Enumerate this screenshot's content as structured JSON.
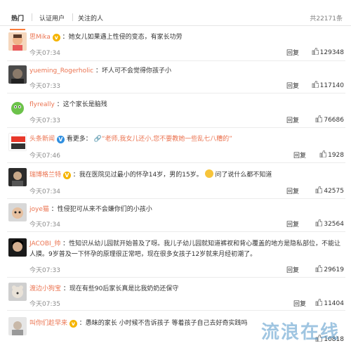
{
  "tabs": [
    "热门",
    "认证用户",
    "关注的人"
  ],
  "total": "共22171条",
  "reply_label": "回复",
  "comments": [
    {
      "user": "思Mika",
      "text": "：她女儿如果遇上性侵的变态，有家长功劳",
      "time": "今天07:34",
      "likes": "129348",
      "badge": "v-yellow"
    },
    {
      "user": "yueming_Rogerholic",
      "text": "：坏人可不会觉得你孩子小",
      "time": "今天07:33",
      "likes": "117140",
      "badge": ""
    },
    {
      "user": "flyreally",
      "text": "：这个家长是脑残",
      "time": "今天07:33",
      "likes": "76686",
      "badge": ""
    },
    {
      "user": "头条新闻",
      "text_pre": " 看更多：",
      "link": "“老师,我女儿还小,您不要教她一些乱七八糟的”",
      "time": "今天07:46",
      "likes": "1928",
      "badge": "V-blue",
      "avatar_text": "头条\n新闻"
    },
    {
      "user": "瑞博格兰特",
      "text": "：我在医院见过最小的怀孕14岁，男的15岁。",
      "text_post": "问了说什么都不知道",
      "time": "今天07:34",
      "likes": "42575",
      "badge": "V"
    },
    {
      "user": "joye猫",
      "text": "：性侵犯可从来不会嫌你们的小孩小",
      "time": "今天07:34",
      "likes": "32564",
      "badge": ""
    },
    {
      "user": "JACOBI_帅",
      "text": "：性知识从幼儿园就开始普及了呀。我儿子幼儿园就知道裤衩和背心覆盖的地方是隐私部位，不能让人摸。9岁普及一下怀孕的原理很正常吧，现在很多女孩子12岁就来月经初潮了。",
      "time": "今天07:33",
      "likes": "29619",
      "badge": ""
    },
    {
      "user": "渡边小狗宝",
      "text": "：现在有些90后家长真是比我奶奶还保守",
      "time": "今天07:35",
      "likes": "11404",
      "badge": ""
    },
    {
      "user": "叫你们趁早来",
      "text": "：愚昧的家长 小时候不告诉孩子 等着孩子自己去好奇实践吗",
      "time": "",
      "likes": "10818",
      "badge": "v-yellow"
    }
  ],
  "watermark": "流浪在线",
  "colors": {
    "accent": "#eb7350",
    "tab_indicator": "#fa7d3c",
    "muted": "#8c8c8c"
  }
}
